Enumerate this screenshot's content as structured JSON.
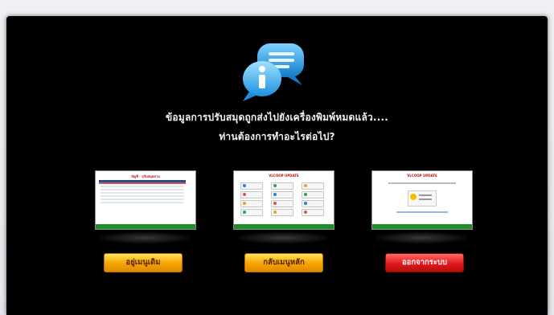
{
  "dialog": {
    "message_line1": "ข้อมูลการปรับสมุดถูกส่งไปยังเครื่องพิมพ์หมดแล้ว....",
    "message_line2": "ท่านต้องการทำอะไรต่อไป?",
    "info_icon": "info-speech-bubble-icon"
  },
  "options": [
    {
      "thumb_title": "บัญชี - ปรับสมุดคาม",
      "button_label": "อยู่เมนูเดิม",
      "button_color": "#f5a300"
    },
    {
      "thumb_title": "VLCOOP UPDATE",
      "button_label": "กลับเมนูหลัก",
      "button_color": "#f5a300"
    },
    {
      "thumb_title": "VLCOOP UPDATE",
      "button_label": "ออกจากระบบ",
      "button_color": "#e21b1b"
    }
  ],
  "colors": {
    "background": "#000000",
    "accent_gold": "#f5a300",
    "accent_red": "#e21b1b",
    "footer_green": "#1f8f2a"
  }
}
